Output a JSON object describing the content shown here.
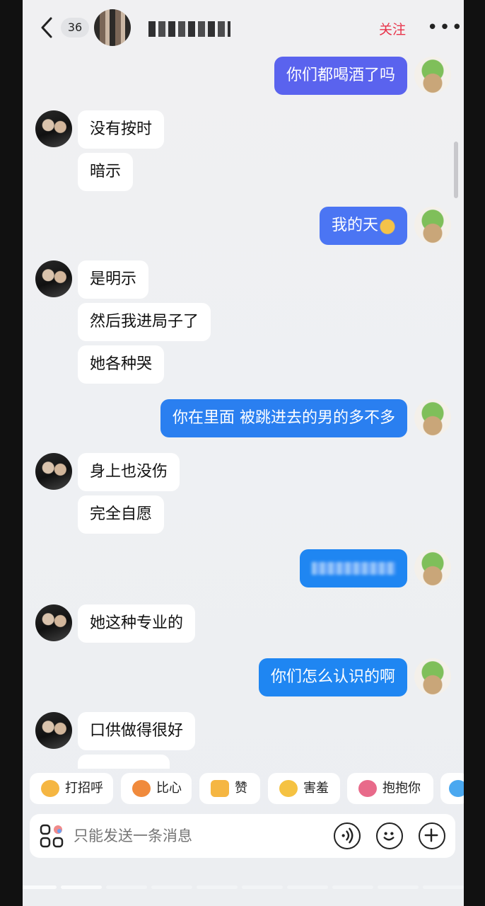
{
  "header": {
    "unread_count": "36",
    "follow_label": "关注",
    "more_label": "•••"
  },
  "messages": [
    {
      "side": "out",
      "text": "你们都喝酒了吗"
    },
    {
      "side": "in",
      "text": "没有按时"
    },
    {
      "side": "in",
      "text": "暗示"
    },
    {
      "side": "out",
      "text": "我的天"
    },
    {
      "side": "in",
      "text": "是明示"
    },
    {
      "side": "in",
      "text": "然后我进局子了"
    },
    {
      "side": "in",
      "text": "她各种哭"
    },
    {
      "side": "out",
      "text": "你在里面 被跳进去的男的多不多"
    },
    {
      "side": "in",
      "text": "身上也没伤"
    },
    {
      "side": "in",
      "text": "完全自愿"
    },
    {
      "side": "out",
      "text": ""
    },
    {
      "side": "in",
      "text": "她这种专业的"
    },
    {
      "side": "out",
      "text": "你们怎么认识的啊"
    },
    {
      "side": "in",
      "text": "口供做得很好"
    }
  ],
  "quick_replies": [
    {
      "label": "打招呼",
      "icon": "smile-wave-icon",
      "color": "#f5b642"
    },
    {
      "label": "比心",
      "icon": "heart-hands-icon",
      "color": "#f08a3c"
    },
    {
      "label": "赞",
      "icon": "thumbs-up-icon",
      "color": "#f5b642"
    },
    {
      "label": "害羞",
      "icon": "shy-face-icon",
      "color": "#f5c242"
    },
    {
      "label": "抱抱你",
      "icon": "hug-icon",
      "color": "#e86a8a"
    }
  ],
  "input": {
    "placeholder": "只能发送一条消息"
  },
  "colors": {
    "follow": "#e8334a",
    "bubble_out": "#4a78f4",
    "bubble_in": "#ffffff"
  }
}
